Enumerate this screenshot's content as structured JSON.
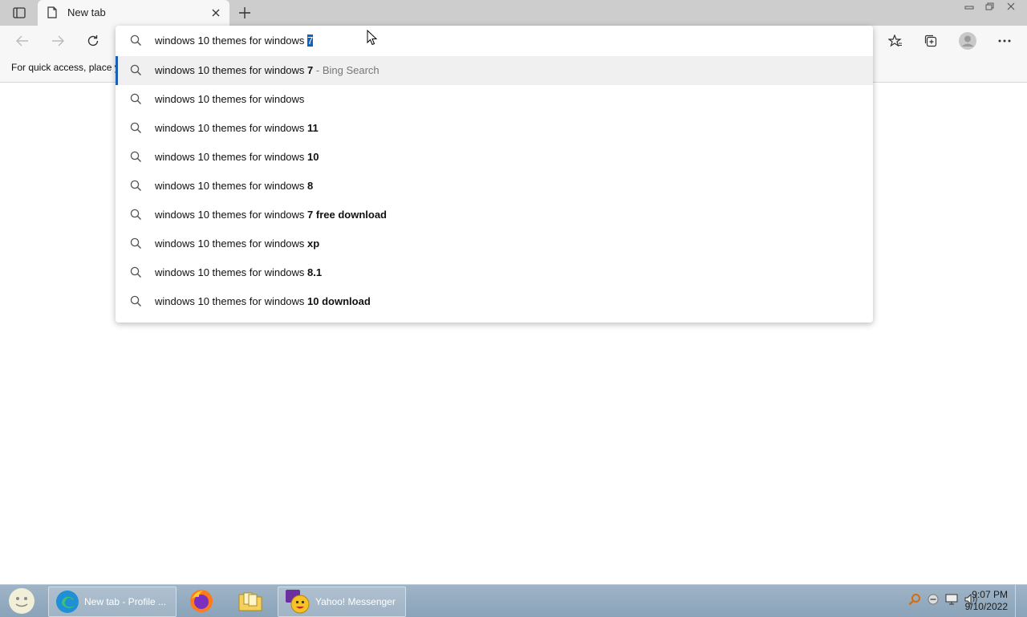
{
  "browser": {
    "tab": {
      "title": "New tab"
    },
    "favorites_bar": {
      "message": "For quick access, place y"
    }
  },
  "omnibox": {
    "typed_prefix": "windows 10 themes for windows ",
    "selected_completion": "7",
    "suggestions": [
      {
        "prefix": "windows 10 themes for windows ",
        "bold": "7",
        "extra": " - Bing Search",
        "active": true
      },
      {
        "prefix": "windows 10 themes for windows",
        "bold": "",
        "extra": "",
        "active": false
      },
      {
        "prefix": "windows 10 themes for windows ",
        "bold": "11",
        "extra": "",
        "active": false
      },
      {
        "prefix": "windows 10 themes for windows ",
        "bold": "10",
        "extra": "",
        "active": false
      },
      {
        "prefix": "windows 10 themes for windows ",
        "bold": "8",
        "extra": "",
        "active": false
      },
      {
        "prefix": "windows 10 themes for windows ",
        "bold": "7 free download",
        "extra": "",
        "active": false
      },
      {
        "prefix": "windows 10 themes for windows ",
        "bold": "xp",
        "extra": "",
        "active": false
      },
      {
        "prefix": "windows 10 themes for windows ",
        "bold": "8.1",
        "extra": "",
        "active": false
      },
      {
        "prefix": "windows 10 themes for windows ",
        "bold": "10 download",
        "extra": "",
        "active": false
      }
    ]
  },
  "taskbar": {
    "items": [
      {
        "label": "New tab - Profile ..."
      },
      {
        "label": "Yahoo! Messenger"
      }
    ],
    "clock": {
      "time": "9:07 PM",
      "date": "9/10/2022"
    }
  },
  "colors": {
    "selection": "#0a64c8",
    "active_indicator": "#1a5fb4",
    "taskbar": "#8aa3b8"
  }
}
